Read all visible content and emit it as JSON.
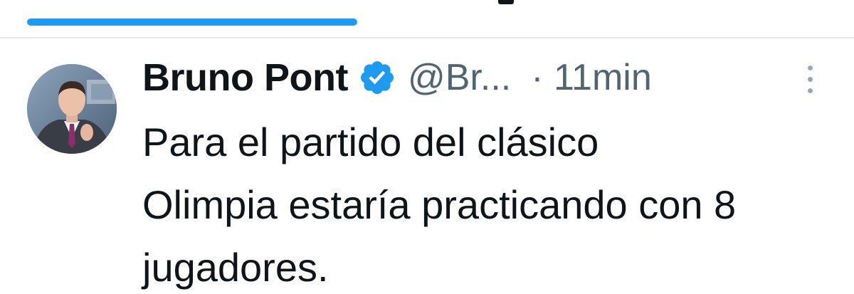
{
  "tweet": {
    "author_name": "Bruno Pont",
    "handle": "@Br...",
    "timestamp": "· 11min",
    "text_lines": [
      "Para el partido del clásico",
      "Olimpia estaría practicando con 8",
      "jugadores."
    ]
  },
  "icons": {
    "verified": "verified-badge-icon",
    "more": "more-options-icon"
  },
  "colors": {
    "accent": "#1d9bf0",
    "text_primary": "#0f1419",
    "text_secondary": "#536471",
    "divider": "#e7e9ea"
  }
}
